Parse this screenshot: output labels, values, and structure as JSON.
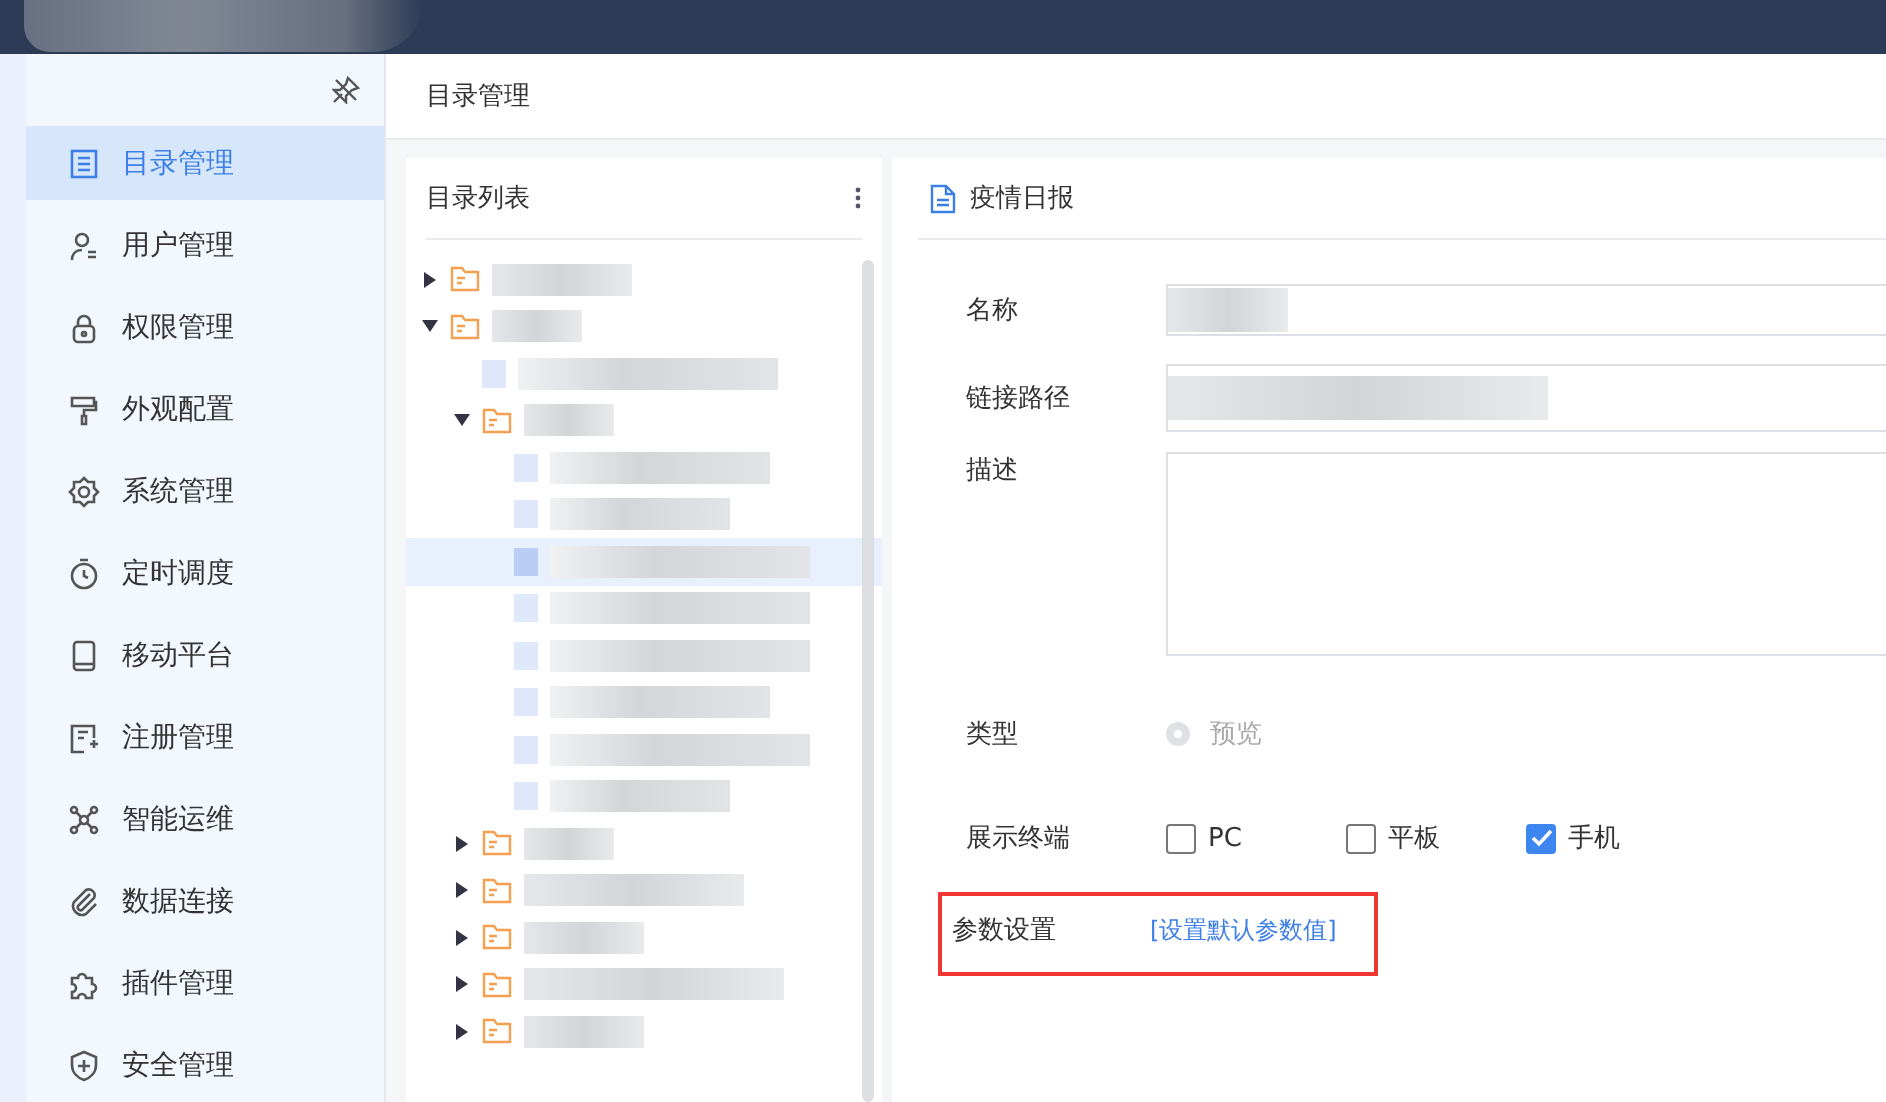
{
  "sidebar": {
    "items": [
      {
        "label": "目录管理",
        "selected": true
      },
      {
        "label": "用户管理",
        "selected": false
      },
      {
        "label": "权限管理",
        "selected": false
      },
      {
        "label": "外观配置",
        "selected": false
      },
      {
        "label": "系统管理",
        "selected": false
      },
      {
        "label": "定时调度",
        "selected": false
      },
      {
        "label": "移动平台",
        "selected": false
      },
      {
        "label": "注册管理",
        "selected": false
      },
      {
        "label": "智能运维",
        "selected": false
      },
      {
        "label": "数据连接",
        "selected": false
      },
      {
        "label": "插件管理",
        "selected": false
      },
      {
        "label": "安全管理",
        "selected": false
      }
    ]
  },
  "breadcrumb": "目录管理",
  "tree": {
    "title": "目录列表",
    "items": [
      {
        "kind": "folder",
        "expanded": false,
        "selected": false
      },
      {
        "kind": "folder",
        "expanded": true,
        "selected": false,
        "children": [
          {
            "kind": "file",
            "selected": false
          },
          {
            "kind": "folder",
            "expanded": true,
            "selected": false,
            "children": [
              {
                "kind": "file",
                "selected": false
              },
              {
                "kind": "file",
                "selected": false
              },
              {
                "kind": "file",
                "selected": true
              },
              {
                "kind": "file",
                "selected": false
              },
              {
                "kind": "file",
                "selected": false
              },
              {
                "kind": "file",
                "selected": false
              },
              {
                "kind": "file",
                "selected": false
              },
              {
                "kind": "file",
                "selected": false
              }
            ]
          },
          {
            "kind": "folder",
            "expanded": false,
            "selected": false
          },
          {
            "kind": "folder",
            "expanded": false,
            "selected": false
          },
          {
            "kind": "folder",
            "expanded": false,
            "selected": false
          },
          {
            "kind": "folder",
            "expanded": false,
            "selected": false
          },
          {
            "kind": "folder",
            "expanded": false,
            "selected": false
          }
        ]
      }
    ]
  },
  "detail": {
    "title": "疫情日报",
    "fields": [
      {
        "kind": "input",
        "label": "名称"
      },
      {
        "kind": "input",
        "label": "链接路径"
      },
      {
        "kind": "textarea",
        "label": "描述"
      },
      {
        "kind": "radio",
        "label": "类型",
        "options": [
          {
            "label": "预览",
            "selected": true,
            "disabled": true
          }
        ]
      },
      {
        "kind": "checkboxes",
        "label": "展示终端",
        "options": [
          {
            "label": "PC",
            "checked": false
          },
          {
            "label": "平板",
            "checked": false
          },
          {
            "label": "手机",
            "checked": true
          }
        ]
      },
      {
        "kind": "link",
        "label": "参数设置",
        "link": "[设置默认参数值]",
        "highlighted": true
      }
    ]
  }
}
